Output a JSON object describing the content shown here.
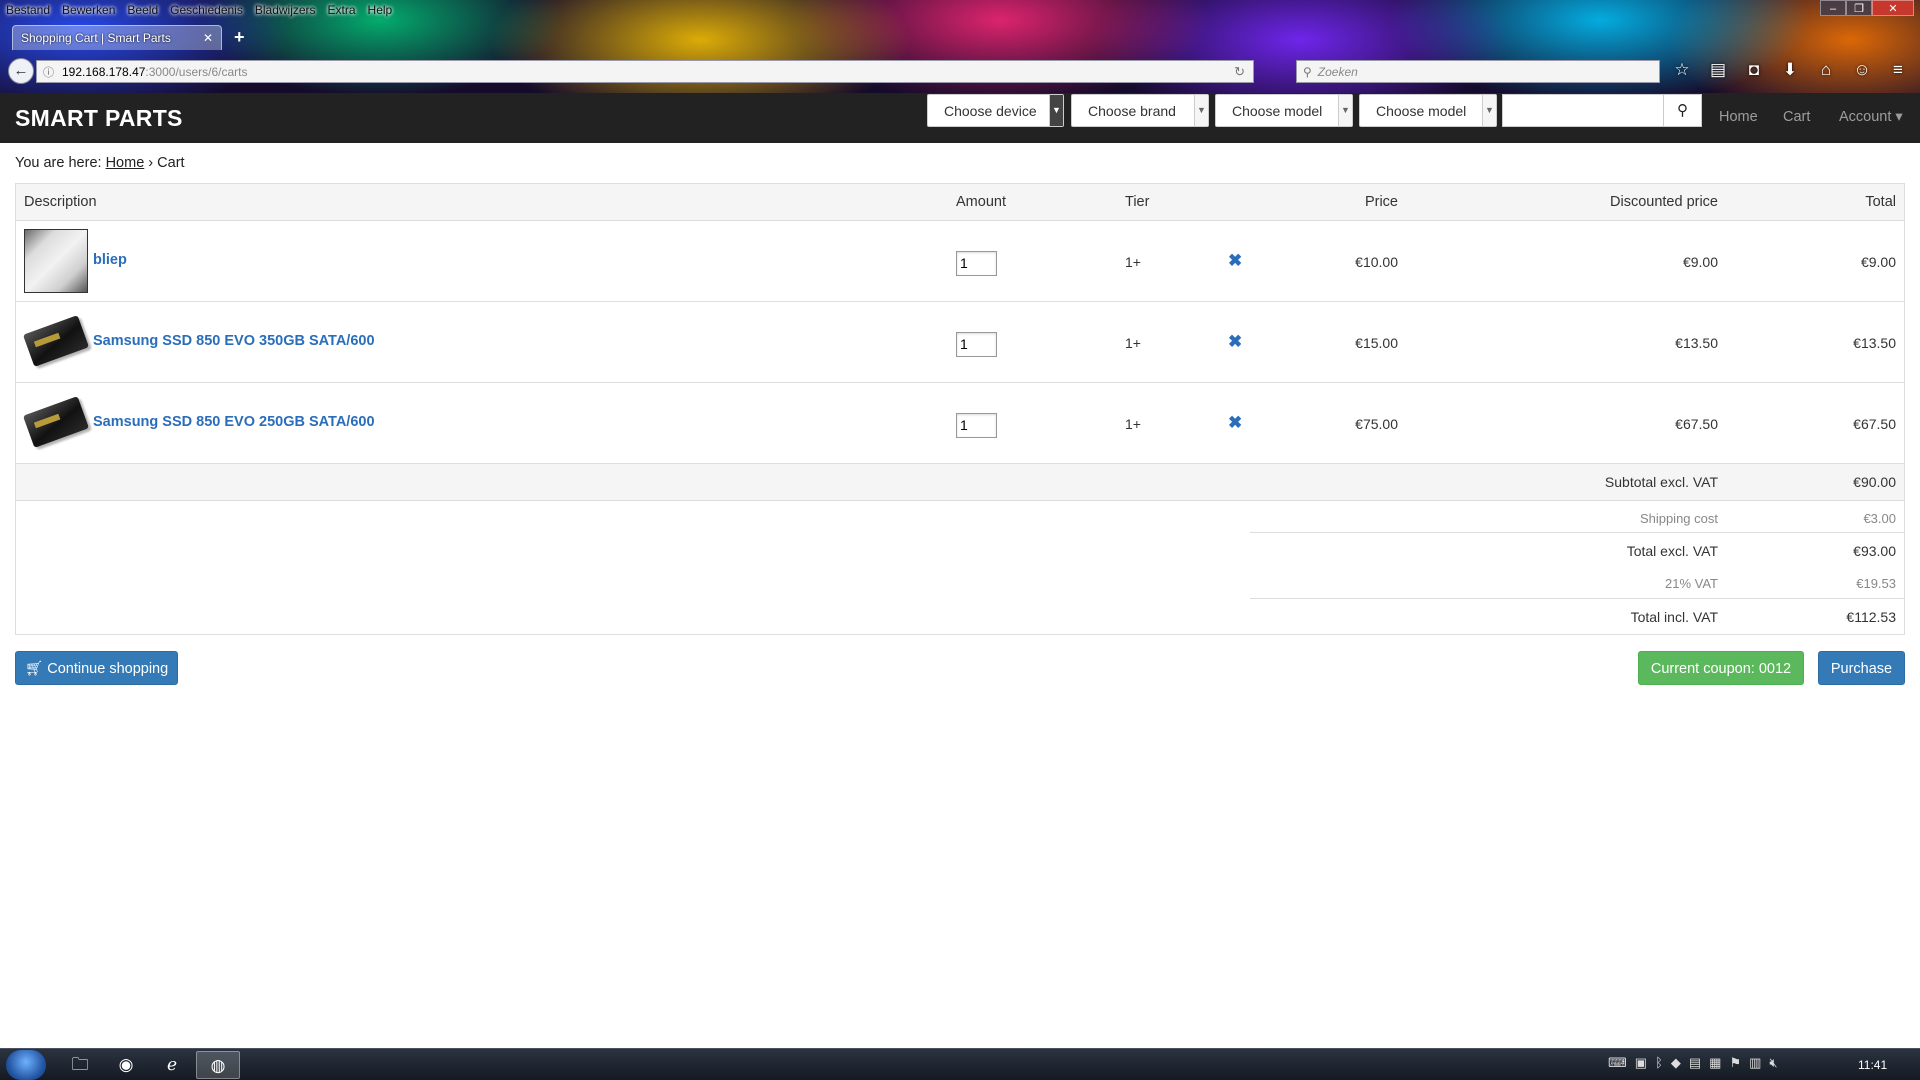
{
  "browser": {
    "menu": [
      "Bestand",
      "Bewerken",
      "Beeld",
      "Geschiedenis",
      "Bladwijzers",
      "Extra",
      "Help"
    ],
    "tab_title": "Shopping Cart | Smart Parts",
    "url_host": "192.168.178.47",
    "url_path": ":3000/users/6/carts",
    "search_placeholder": "Zoeken"
  },
  "navbar": {
    "brand": "SMART PARTS",
    "selects": [
      "Choose device",
      "Choose brand",
      "Choose model",
      "Choose model"
    ],
    "search_value": "",
    "links": {
      "home": "Home",
      "cart": "Cart",
      "account": "Account ▾"
    }
  },
  "breadcrumb": {
    "prefix": "You are here:",
    "home": "Home",
    "sep": "›",
    "current": "Cart"
  },
  "cart": {
    "columns": [
      "Description",
      "Amount",
      "Tier",
      "Price",
      "Discounted price",
      "Total"
    ],
    "items": [
      {
        "name": "bliep",
        "amount": "1",
        "tier": "1+",
        "price": "€10.00",
        "discounted": "€9.00",
        "total": "€9.00"
      },
      {
        "name": "Samsung SSD 850 EVO 350GB SATA/600",
        "amount": "1",
        "tier": "1+",
        "price": "€15.00",
        "discounted": "€13.50",
        "total": "€13.50"
      },
      {
        "name": "Samsung SSD 850 EVO 250GB SATA/600",
        "amount": "1",
        "tier": "1+",
        "price": "€75.00",
        "discounted": "€67.50",
        "total": "€67.50"
      }
    ],
    "summary": {
      "subtotal_label": "Subtotal excl. VAT",
      "subtotal": "€90.00",
      "shipping_label": "Shipping cost",
      "shipping": "€3.00",
      "total_excl_label": "Total excl. VAT",
      "total_excl": "€93.00",
      "vat_label": "21% VAT",
      "vat": "€19.53",
      "total_incl_label": "Total incl. VAT",
      "total_incl": "€112.53"
    }
  },
  "actions": {
    "continue": "Continue shopping",
    "coupon": "Current coupon: 0012",
    "purchase": "Purchase"
  },
  "taskbar": {
    "clock": "11:41"
  },
  "colors": {
    "link": "#2a6ebb",
    "primary": "#337ab7",
    "success": "#5cb85c",
    "navbar": "#222222"
  }
}
